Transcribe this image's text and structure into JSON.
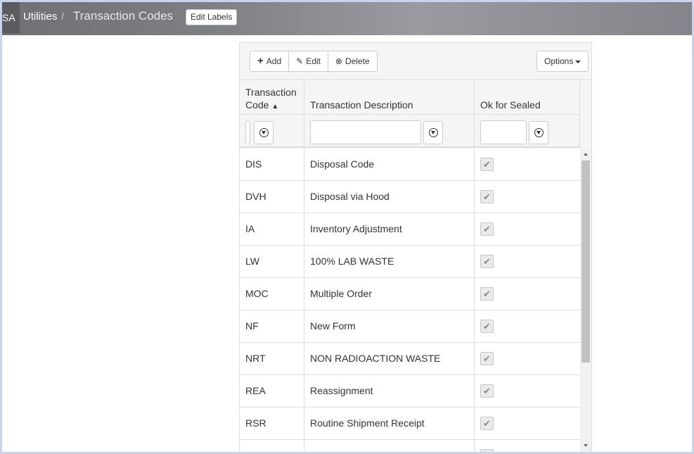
{
  "header": {
    "brand": "SA",
    "breadcrumb_link": "Utilities",
    "breadcrumb_separator": "/",
    "page_title": "Transaction Codes",
    "edit_labels": "Edit Labels"
  },
  "toolbar": {
    "add_label": "Add",
    "edit_label": "Edit",
    "delete_label": "Delete",
    "options_label": "Options"
  },
  "table": {
    "columns": {
      "code_line1": "Transaction",
      "code_line2": "Code",
      "sort_indicator": "▲",
      "description": "Transaction Description",
      "sealed": "Ok for Sealed"
    },
    "rows": [
      {
        "code": "DIS",
        "description": "Disposal Code",
        "sealed": true
      },
      {
        "code": "DVH",
        "description": "Disposal via Hood",
        "sealed": true
      },
      {
        "code": "IA",
        "description": "Inventory Adjustment",
        "sealed": true
      },
      {
        "code": "LW",
        "description": "100% LAB WASTE",
        "sealed": true
      },
      {
        "code": "MOC",
        "description": "Multiple Order",
        "sealed": true
      },
      {
        "code": "NF",
        "description": "New Form",
        "sealed": true
      },
      {
        "code": "NRT",
        "description": "NON RADIOACTION WASTE",
        "sealed": true
      },
      {
        "code": "REA",
        "description": "Reassignment",
        "sealed": true
      },
      {
        "code": "RSR",
        "description": "Routine Shipment Receipt",
        "sealed": true
      }
    ]
  }
}
